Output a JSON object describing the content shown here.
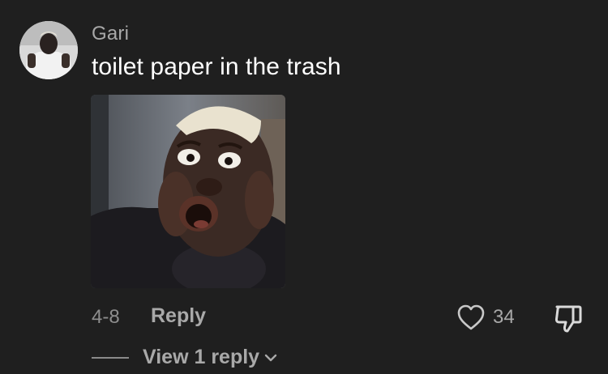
{
  "comment": {
    "username": "Gari",
    "text": "toilet paper in the trash",
    "date": "4-8",
    "reply_label": "Reply",
    "like_count": "34",
    "view_replies_label": "View 1 reply"
  },
  "icons": {
    "like": "heart-icon",
    "dislike": "thumbs-down-icon",
    "expand": "chevron-down-icon"
  },
  "colors": {
    "background": "#1f1f1f",
    "text_primary": "#ffffff",
    "text_secondary": "#a8a8a8"
  }
}
